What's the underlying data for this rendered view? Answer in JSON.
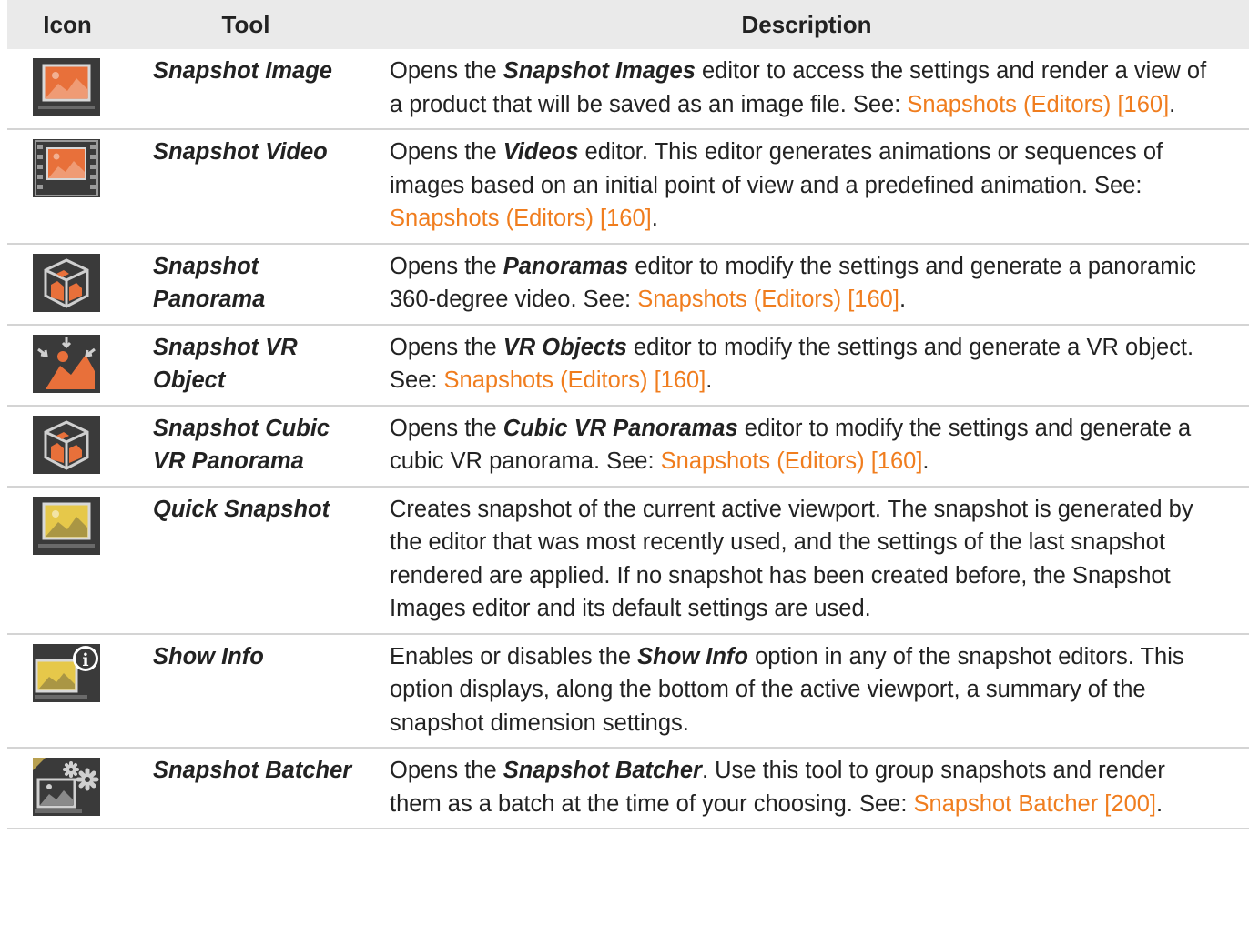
{
  "header": {
    "icon": "Icon",
    "tool": "Tool",
    "description": "Description"
  },
  "colors": {
    "link": "#f07d1e",
    "icon_bg": "#3a3a3a",
    "icon_orange": "#e8703a",
    "icon_yellow": "#e6c84a",
    "header_bg": "#eaeaea"
  },
  "rows": [
    {
      "icon": "snapshot-image-icon",
      "tool": "Snapshot Image",
      "d_a": "Opens the ",
      "d_b": "Snapshot Images",
      "d_c": " editor to access the settings and render a view of a product that will be saved as an image file. See: ",
      "link": "Snapshots (Editors) [160]",
      "d_end": "."
    },
    {
      "icon": "snapshot-video-icon",
      "tool": "Snapshot Video",
      "d_a": "Opens the ",
      "d_b": "Videos",
      "d_c": " editor. This editor generates animations or sequences of images based on an initial point of view and a predefined animation. See: ",
      "link": "Snapshots (Editors) [160]",
      "d_end": "."
    },
    {
      "icon": "snapshot-panorama-icon",
      "tool": "Snapshot Panorama",
      "d_a": "Opens the ",
      "d_b": "Panoramas",
      "d_c": " editor to modify the settings and generate a panoramic 360-degree video. See: ",
      "link": "Snapshots (Editors) [160]",
      "d_end": "."
    },
    {
      "icon": "snapshot-vr-object-icon",
      "tool": "Snapshot VR Object",
      "d_a": "Opens the ",
      "d_b": "VR Objects",
      "d_c": " editor to modify the settings and generate a VR object. See: ",
      "link": "Snapshots (Editors) [160]",
      "d_end": "."
    },
    {
      "icon": "snapshot-cubic-vr-panorama-icon",
      "tool": "Snapshot Cubic VR Panorama",
      "d_a": "Opens the ",
      "d_b": "Cubic VR Panoramas",
      "d_c": " editor to modify the settings and generate a cubic VR panorama. See: ",
      "link": "Snapshots (Editors) [160]",
      "d_end": "."
    },
    {
      "icon": "quick-snapshot-icon",
      "tool": "Quick Snapshot",
      "d_a": "Creates snapshot of the current active viewport. The snapshot is generated by the editor that was most recently used, and the settings of the last snapshot rendered are applied. If no snapshot has been created before, the Snapshot Images editor and its default settings are used."
    },
    {
      "icon": "show-info-icon",
      "tool": "Show Info",
      "d_a": "Enables or disables the ",
      "d_b": "Show Info",
      "d_c": " option in any of the snapshot editors. This option displays, along the bottom of the active viewport, a summary of the snapshot dimension settings."
    },
    {
      "icon": "snapshot-batcher-icon",
      "tool": "Snapshot Batcher",
      "d_a": "Opens the ",
      "d_b": "Snapshot Batcher",
      "d_c": ". Use this tool to group snapshots and render them as a batch at the time of your choosing. See: ",
      "link": "Snapshot Batcher [200]",
      "d_end": "."
    }
  ]
}
